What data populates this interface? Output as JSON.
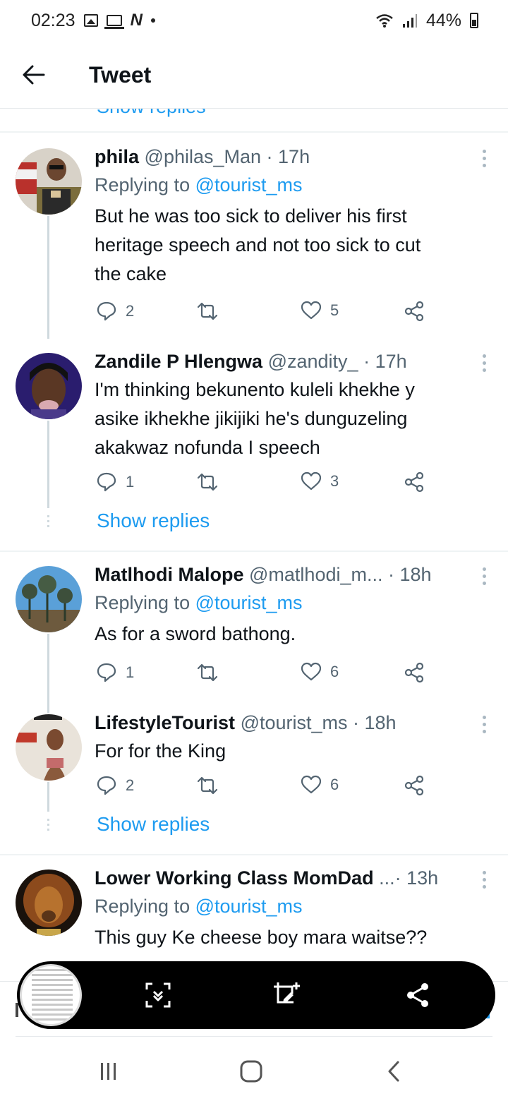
{
  "status_bar": {
    "time": "02:23",
    "battery": "44%"
  },
  "header": {
    "title": "Tweet"
  },
  "partial_show_replies": "Show replies",
  "tweets": [
    {
      "name": "phila",
      "handle": "@philas_Man",
      "time": "· 17h",
      "replying_label": "Replying to",
      "replying_handle": "@tourist_ms",
      "lines": [
        "But he was too sick to deliver his first",
        "heritage speech and not too sick to cut",
        "the cake"
      ],
      "replies": "2",
      "likes": "5"
    },
    {
      "name": "Zandile P Hlengwa",
      "handle": "@zandity_",
      "time": "· 17h",
      "lines": [
        "I'm thinking bekunento kuleli khekhe y",
        "asike ikhekhe jikijiki he's dunguzeling",
        "akakwaz nofunda I speech"
      ],
      "replies": "1",
      "likes": "3",
      "show_replies": "Show replies"
    },
    {
      "name": "Matlhodi Malope",
      "handle": "@matlhodi_m...",
      "time": "· 18h",
      "replying_label": "Replying to",
      "replying_handle": "@tourist_ms",
      "lines": [
        "As for a sword bathong."
      ],
      "replies": "1",
      "likes": "6"
    },
    {
      "name": "LifestyleTourist",
      "handle": "@tourist_ms",
      "time": "· 18h",
      "lines": [
        "For for the King"
      ],
      "replies": "2",
      "likes": "6",
      "show_replies": "Show replies"
    },
    {
      "name": "Lower Working Class MomDad",
      "handle": "...",
      "time": "· 13h",
      "replying_label": "Replying to",
      "replying_handle": "@tourist_ms",
      "lines": [
        "This guy Ke cheese boy mara waitse??"
      ]
    }
  ],
  "colors": {
    "accent": "#1d9bf0",
    "muted": "#536471",
    "text": "#0f1419",
    "thread_line": "#cfd9de"
  },
  "toolbar_icons": [
    "scroll-capture-icon",
    "crop-edit-icon",
    "share-icon"
  ],
  "nav_icons": [
    "recents-icon",
    "home-icon",
    "back-icon"
  ]
}
